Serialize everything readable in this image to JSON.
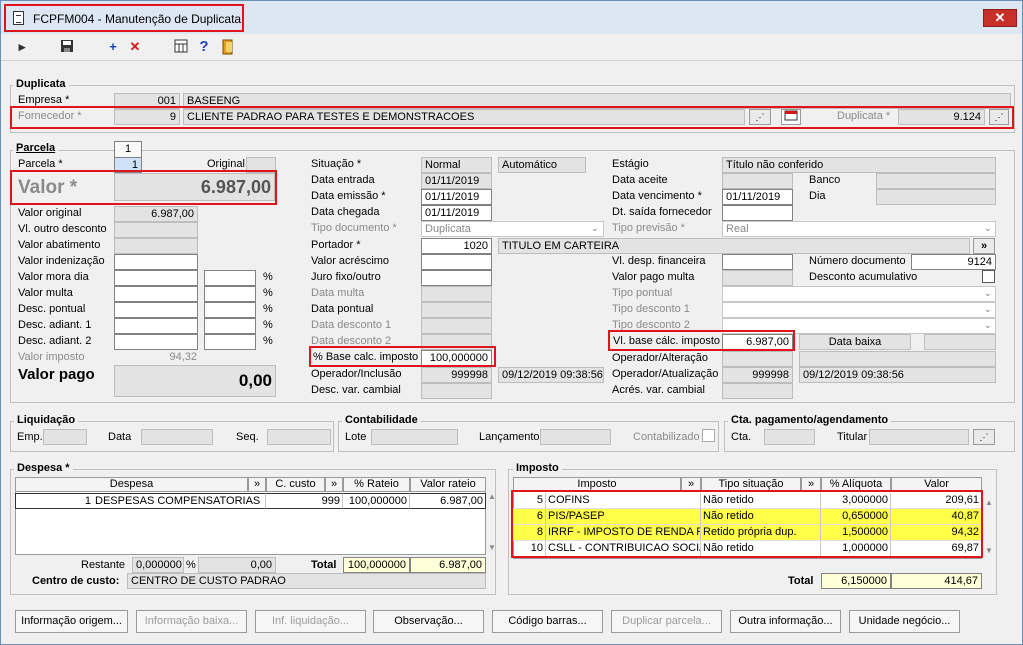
{
  "window": {
    "title": "FCPFM004 - Manutenção de Duplicata",
    "close": "✕"
  },
  "toolbar": {
    "new": "+",
    "delete": "✕",
    "help": "?"
  },
  "duplicata": {
    "section": "Duplicata",
    "empresa_label": "Empresa *",
    "empresa_code": "001",
    "empresa_name": "BASEENG",
    "fornecedor_label": "Fornecedor *",
    "fornecedor_code": "9",
    "fornecedor_name": "CLIENTE PADRAO PARA TESTES E DEMONSTRACOES",
    "duplicata_label": "Duplicata *",
    "duplicata_value": "9.124"
  },
  "parcela": {
    "section": "Parcela",
    "tab": "1",
    "parcela_label": "Parcela *",
    "parcela_value": "1",
    "original_label": "Original",
    "valor_label": "Valor *",
    "valor_value": "6.987,00",
    "valor_original_label": "Valor original",
    "valor_original_value": "6.987,00",
    "outro_desconto_label": "Vl. outro desconto",
    "abatimento_label": "Valor abatimento",
    "indenizacao_label": "Valor indenização",
    "mora_label": "Valor mora dia",
    "multa_label": "Valor multa",
    "desc_pontual_label": "Desc. pontual",
    "desc_adiant1_label": "Desc. adiant. 1",
    "desc_adiant2_label": "Desc. adiant. 2",
    "pct": "%",
    "valor_imposto_label": "Valor imposto",
    "valor_imposto_value": "94,32",
    "valor_pago_label": "Valor pago",
    "valor_pago_value": "0,00"
  },
  "middle": {
    "situacao_label": "Situação *",
    "situacao_value": "Normal",
    "situacao_mode": "Automático",
    "data_entrada_label": "Data entrada",
    "data_entrada": "01/11/2019",
    "data_emissao_label": "Data emissão *",
    "data_emissao": "01/11/2019",
    "data_chegada_label": "Data chegada",
    "data_chegada": "01/11/2019",
    "tipo_documento_label": "Tipo documento *",
    "tipo_documento": "Duplicata",
    "portador_label": "Portador *",
    "portador_code": "1020",
    "portador_name": "TITULO EM CARTEIRA",
    "valor_acrescimo_label": "Valor acréscimo",
    "juro_label": "Juro fixo/outro",
    "data_multa_label": "Data multa",
    "data_pontual_label": "Data pontual",
    "data_desconto1_label": "Data desconto 1",
    "data_desconto2_label": "Data desconto 2",
    "pct_base_label": "% Base calc. imposto",
    "pct_base_value": "100,000000",
    "operador_inclusao_label": "Operador/Inclusão",
    "operador_inclusao": "999998",
    "inclusao_data": "09/12/2019 09:38:56",
    "desc_var_label": "Desc. var. cambial"
  },
  "right": {
    "estagio_label": "Estágio",
    "estagio_value": "Título não conferido",
    "data_aceite_label": "Data aceite",
    "banco_label": "Banco",
    "data_vencimento_label": "Data vencimento *",
    "data_vencimento": "01/11/2019",
    "dia_label": "Dia",
    "dt_saida_label": "Dt. saída fornecedor",
    "tipo_previsao_label": "Tipo previsão *",
    "tipo_previsao": "Real",
    "vl_desp_label": "Vl. desp. financeira",
    "numero_documento_label": "Número documento",
    "numero_documento": "9124",
    "valor_pago_multa_label": "Valor pago multa",
    "desconto_acumulativo_label": "Desconto acumulativo",
    "tipo_pontual_label": "Tipo pontual",
    "tipo_desconto1_label": "Tipo desconto 1",
    "tipo_desconto2_label": "Tipo desconto 2",
    "vl_base_label": "Vl. base cálc. imposto",
    "vl_base_value": "6.987,00",
    "data_baixa_label": "Data baixa",
    "operador_alteracao_label": "Operador/Alteração",
    "operador_atualizacao_label": "Operador/Atualização",
    "operador_atualizacao": "999998",
    "atualizacao_data": "09/12/2019 09:38:56",
    "acres_var_label": "Acrés. var. cambial"
  },
  "liquidacao": {
    "section": "Liquidação",
    "emp_label": "Emp.",
    "data_label": "Data",
    "seq_label": "Seq."
  },
  "contabilidade": {
    "section": "Contabilidade",
    "lote_label": "Lote",
    "lancamento_label": "Lançamento",
    "contabilizado_label": "Contabilizado"
  },
  "cta": {
    "section": "Cta. pagamento/agendamento",
    "cta_label": "Cta.",
    "titular_label": "Titular"
  },
  "despesa": {
    "section": "Despesa *",
    "headers": [
      "Despesa",
      "»",
      "C. custo",
      "»",
      "% Rateio",
      "Valor rateio"
    ],
    "rows": [
      {
        "code": "1",
        "name": "DESPESAS COMPENSATORIAS",
        "ccusto": "999",
        "rateio": "100,000000",
        "valor": "6.987,00"
      }
    ],
    "restante_label": "Restante",
    "restante_pct": "0,000000",
    "pct": "%",
    "restante_valor": "0,00",
    "total_label": "Total",
    "total_pct": "100,000000",
    "total_valor": "6.987,00",
    "centro_label": "Centro de custo:",
    "centro_value": "CENTRO DE CUSTO PADRAO"
  },
  "imposto": {
    "section": "Imposto",
    "headers": [
      "Imposto",
      "»",
      "Tipo situação",
      "»",
      "% Alíquota",
      "Valor"
    ],
    "rows": [
      {
        "code": "5",
        "name": "COFINS",
        "tipo": "Não retido",
        "aliquota": "3,000000",
        "valor": "209,61",
        "highlight": false
      },
      {
        "code": "6",
        "name": "PIS/PASEP",
        "tipo": "Não retido",
        "aliquota": "0,650000",
        "valor": "40,87",
        "highlight": true
      },
      {
        "code": "8",
        "name": "IRRF - IMPOSTO DE RENDA RET",
        "tipo": "Retido própria dup.",
        "aliquota": "1,500000",
        "valor": "94,32",
        "highlight": true
      },
      {
        "code": "10",
        "name": "CSLL - CONTRIBUICAO SOCIAL",
        "tipo": "Não retido",
        "aliquota": "1,000000",
        "valor": "69,87",
        "highlight": false
      }
    ],
    "total_label": "Total",
    "total_aliquota": "6,150000",
    "total_valor": "414,67"
  },
  "buttons": {
    "info_origem": "Informação origem...",
    "info_baixa": "Informação baixa...",
    "inf_liquidacao": "Inf. liquidação...",
    "observacao": "Observação...",
    "codigo_barras": "Código barras...",
    "duplicar_parcela": "Duplicar parcela...",
    "outra_info": "Outra informação...",
    "unidade_negocio": "Unidade negócio..."
  },
  "colors": {
    "highlight_red": "#e0141c",
    "highlight_yellow": "#ffff4a"
  }
}
